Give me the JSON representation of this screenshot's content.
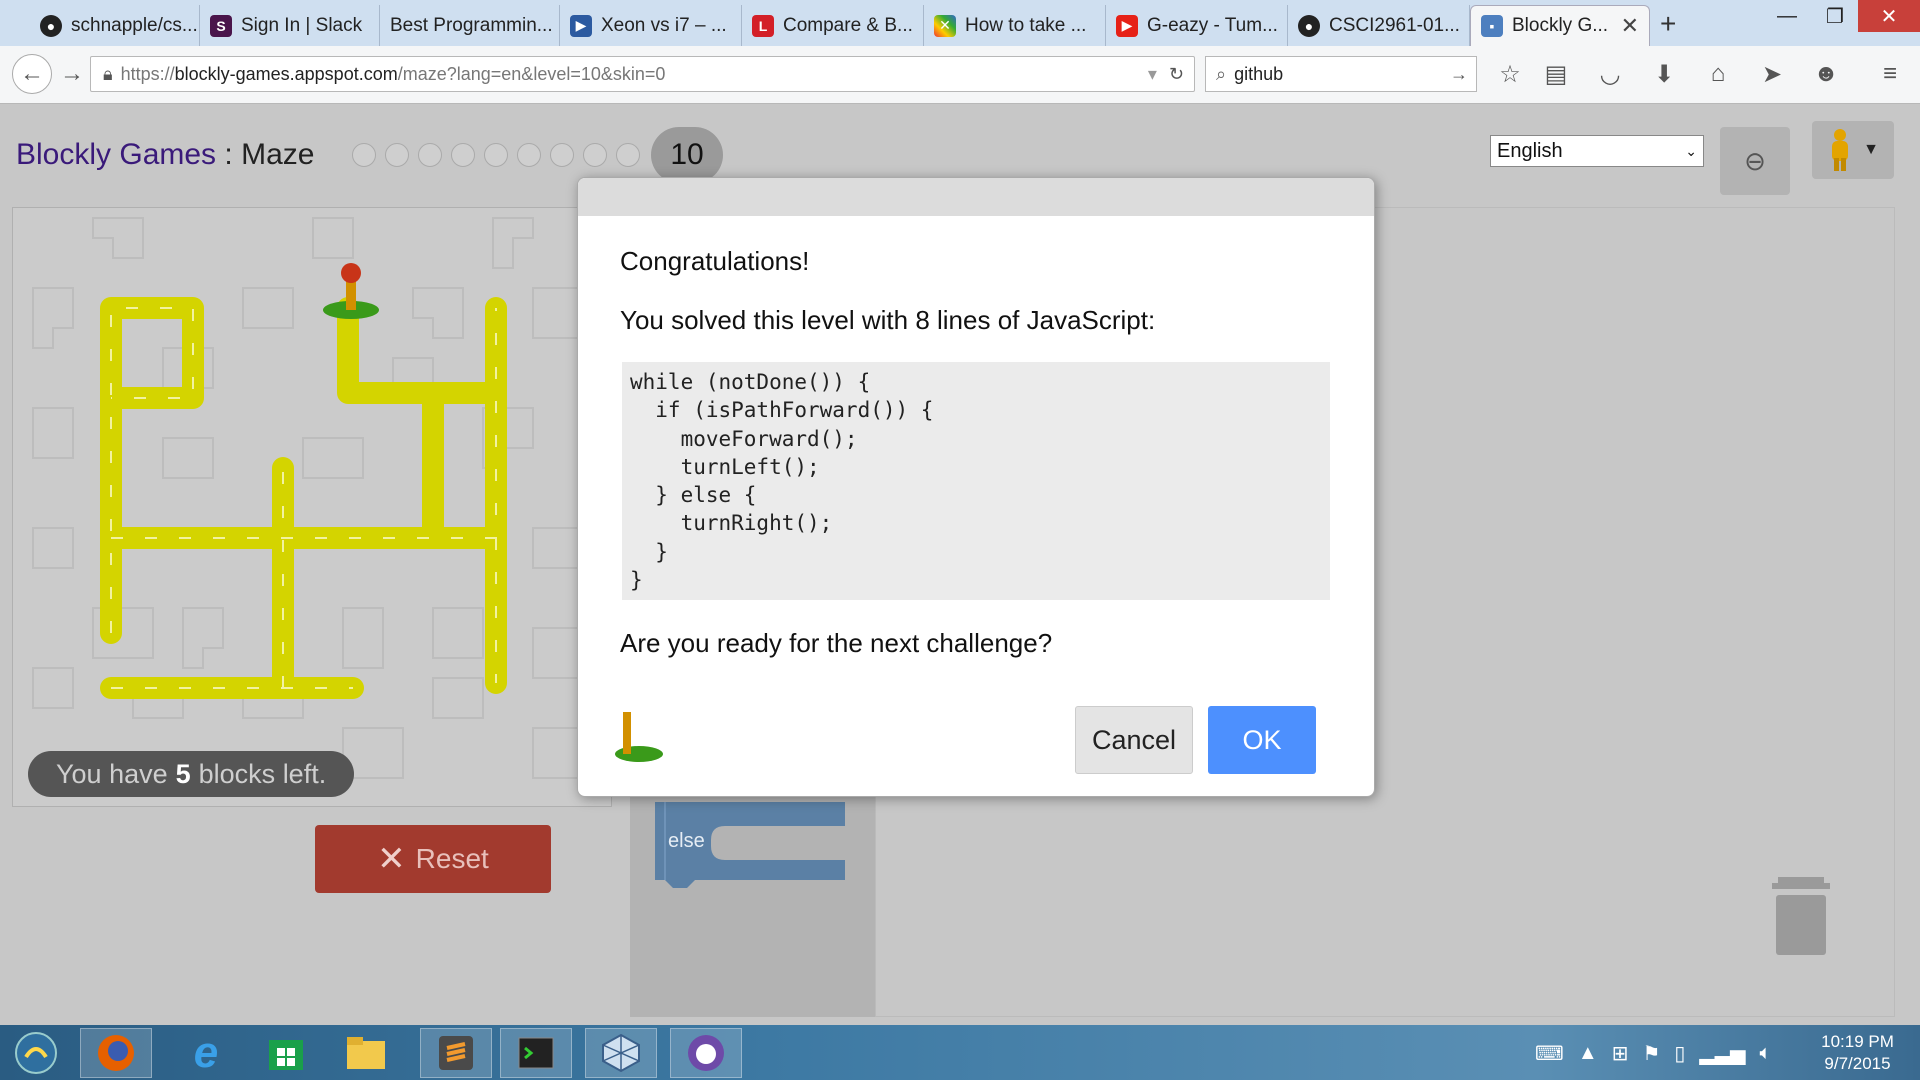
{
  "browser": {
    "tabs": [
      {
        "label": "schnapple/cs...",
        "icon": "github-icon"
      },
      {
        "label": "Sign In | Slack",
        "icon": "slack-icon"
      },
      {
        "label": "Best Programmin...",
        "icon": "blank-icon"
      },
      {
        "label": "Xeon vs i7 – ...",
        "icon": "flag-icon"
      },
      {
        "label": "Compare & B...",
        "icon": "l-icon"
      },
      {
        "label": "How to take ...",
        "icon": "colorful-x-icon"
      },
      {
        "label": "G-eazy - Tum...",
        "icon": "youtube-icon"
      },
      {
        "label": "CSCI2961-01...",
        "icon": "github-icon"
      },
      {
        "label": "Blockly G...",
        "icon": "blockly-icon",
        "active": true
      }
    ],
    "url_prefix": "https://",
    "url_host": "blockly-games.appspot.com",
    "url_path": "/maze?lang=en&level=10&skin=0",
    "search_value": "github"
  },
  "app": {
    "brand": "Blockly Games",
    "separator": " : ",
    "game": "Maze",
    "current_level": "10",
    "total_dots": 9,
    "language": "English",
    "blocks_left_prefix": "You have",
    "blocks_left_count": "5",
    "blocks_left_suffix": "blocks left.",
    "reset_label": "Reset",
    "else_block_label": "else"
  },
  "dialog": {
    "congrats": "Congratulations!",
    "solved": "You solved this level with 8 lines of JavaScript:",
    "code_lines": [
      "while (notDone()) {",
      "  if (isPathForward()) {",
      "    moveForward();",
      "    turnLeft();",
      "  } else {",
      "    turnRight();",
      "  }",
      "}"
    ],
    "ready": "Are you ready for the next challenge?",
    "cancel_label": "Cancel",
    "ok_label": "OK"
  },
  "taskbar": {
    "items": [
      "start-orb-icon",
      "firefox-icon",
      "internet-explorer-icon",
      "windows-store-icon",
      "file-explorer-icon",
      "sublime-text-icon",
      "terminal-icon",
      "virtualbox-icon",
      "github-desktop-icon"
    ],
    "time": "10:19 PM",
    "date": "9/7/2015"
  },
  "colors": {
    "path_yellow": "#d4d400",
    "ok_blue": "#4d90fe",
    "reset_red": "#a23a2e",
    "brand_purple": "#3a1a7a"
  }
}
